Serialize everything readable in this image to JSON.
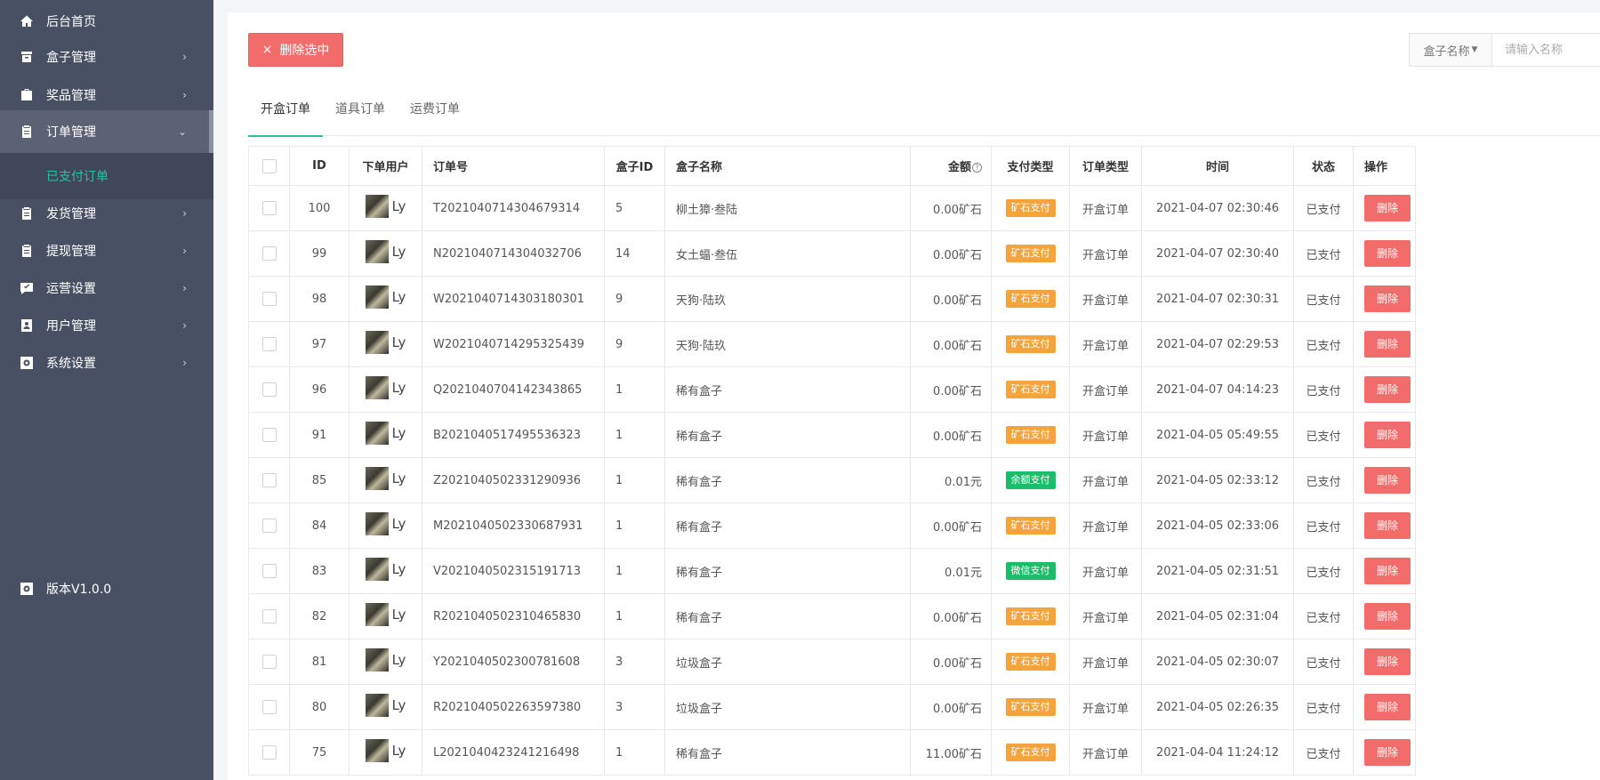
{
  "sidebar": {
    "items": [
      {
        "label": "后台首页",
        "icon": "home-icon",
        "arrow": ""
      },
      {
        "label": "盒子管理",
        "icon": "box-icon",
        "arrow": "›"
      },
      {
        "label": "奖品管理",
        "icon": "bag-icon",
        "arrow": "›"
      },
      {
        "label": "订单管理",
        "icon": "clipboard-icon",
        "arrow": "⌄"
      },
      {
        "label": "发货管理",
        "icon": "clipboard-icon",
        "arrow": "›"
      },
      {
        "label": "提现管理",
        "icon": "clipboard-icon",
        "arrow": "›"
      },
      {
        "label": "运营设置",
        "icon": "chat-icon",
        "arrow": "›"
      },
      {
        "label": "用户管理",
        "icon": "user-card-icon",
        "arrow": "›"
      },
      {
        "label": "系统设置",
        "icon": "gear-icon",
        "arrow": "›"
      }
    ],
    "sub_item": "已支付订单",
    "version": "版本V1.0.0"
  },
  "toolbar": {
    "delete_selected": "删除选中",
    "delete_icon": "×",
    "search_select": "盒子名称",
    "search_placeholder": "请输入名称"
  },
  "tabs": [
    "开盒订单",
    "道具订单",
    "运费订单"
  ],
  "table": {
    "headers": [
      "ID",
      "下单用户",
      "订单号",
      "盒子ID",
      "盒子名称",
      "金额",
      "支付类型",
      "订单类型",
      "时间",
      "状态",
      "操作"
    ],
    "rows": [
      {
        "id": "100",
        "user": "Ly",
        "order_no": "T2021040714304679314",
        "box_id": "5",
        "box_name": "柳土獐·叁陆",
        "amount": "0.00矿石",
        "pay_type": "矿石支付",
        "pay_color": "ore",
        "order_type": "开盒订单",
        "time": "2021-04-07 02:30:46",
        "status": "已支付",
        "action": "删除"
      },
      {
        "id": "99",
        "user": "Ly",
        "order_no": "N2021040714304032706",
        "box_id": "14",
        "box_name": "女土蝠·叁伍",
        "amount": "0.00矿石",
        "pay_type": "矿石支付",
        "pay_color": "ore",
        "order_type": "开盒订单",
        "time": "2021-04-07 02:30:40",
        "status": "已支付",
        "action": "删除"
      },
      {
        "id": "98",
        "user": "Ly",
        "order_no": "W2021040714303180301",
        "box_id": "9",
        "box_name": "天狗·陆玖",
        "amount": "0.00矿石",
        "pay_type": "矿石支付",
        "pay_color": "ore",
        "order_type": "开盒订单",
        "time": "2021-04-07 02:30:31",
        "status": "已支付",
        "action": "删除"
      },
      {
        "id": "97",
        "user": "Ly",
        "order_no": "W2021040714295325439",
        "box_id": "9",
        "box_name": "天狗·陆玖",
        "amount": "0.00矿石",
        "pay_type": "矿石支付",
        "pay_color": "ore",
        "order_type": "开盒订单",
        "time": "2021-04-07 02:29:53",
        "status": "已支付",
        "action": "删除"
      },
      {
        "id": "96",
        "user": "Ly",
        "order_no": "Q2021040704142343865",
        "box_id": "1",
        "box_name": "稀有盒子",
        "amount": "0.00矿石",
        "pay_type": "矿石支付",
        "pay_color": "ore",
        "order_type": "开盒订单",
        "time": "2021-04-07 04:14:23",
        "status": "已支付",
        "action": "删除"
      },
      {
        "id": "91",
        "user": "Ly",
        "order_no": "B2021040517495536323",
        "box_id": "1",
        "box_name": "稀有盒子",
        "amount": "0.00矿石",
        "pay_type": "矿石支付",
        "pay_color": "ore",
        "order_type": "开盒订单",
        "time": "2021-04-05 05:49:55",
        "status": "已支付",
        "action": "删除"
      },
      {
        "id": "85",
        "user": "Ly",
        "order_no": "Z2021040502331290936",
        "box_id": "1",
        "box_name": "稀有盒子",
        "amount": "0.01元",
        "pay_type": "余额支付",
        "pay_color": "bal",
        "order_type": "开盒订单",
        "time": "2021-04-05 02:33:12",
        "status": "已支付",
        "action": "删除"
      },
      {
        "id": "84",
        "user": "Ly",
        "order_no": "M2021040502330687931",
        "box_id": "1",
        "box_name": "稀有盒子",
        "amount": "0.00矿石",
        "pay_type": "矿石支付",
        "pay_color": "ore",
        "order_type": "开盒订单",
        "time": "2021-04-05 02:33:06",
        "status": "已支付",
        "action": "删除"
      },
      {
        "id": "83",
        "user": "Ly",
        "order_no": "V2021040502315191713",
        "box_id": "1",
        "box_name": "稀有盒子",
        "amount": "0.01元",
        "pay_type": "微信支付",
        "pay_color": "wx",
        "order_type": "开盒订单",
        "time": "2021-04-05 02:31:51",
        "status": "已支付",
        "action": "删除"
      },
      {
        "id": "82",
        "user": "Ly",
        "order_no": "R2021040502310465830",
        "box_id": "1",
        "box_name": "稀有盒子",
        "amount": "0.00矿石",
        "pay_type": "矿石支付",
        "pay_color": "ore",
        "order_type": "开盒订单",
        "time": "2021-04-05 02:31:04",
        "status": "已支付",
        "action": "删除"
      },
      {
        "id": "81",
        "user": "Ly",
        "order_no": "Y2021040502300781608",
        "box_id": "3",
        "box_name": "垃圾盒子",
        "amount": "0.00矿石",
        "pay_type": "矿石支付",
        "pay_color": "ore",
        "order_type": "开盒订单",
        "time": "2021-04-05 02:30:07",
        "status": "已支付",
        "action": "删除"
      },
      {
        "id": "80",
        "user": "Ly",
        "order_no": "R2021040502263597380",
        "box_id": "3",
        "box_name": "垃圾盒子",
        "amount": "0.00矿石",
        "pay_type": "矿石支付",
        "pay_color": "ore",
        "order_type": "开盒订单",
        "time": "2021-04-05 02:26:35",
        "status": "已支付",
        "action": "删除"
      },
      {
        "id": "75",
        "user": "Ly",
        "order_no": "L2021040423241216498",
        "box_id": "1",
        "box_name": "稀有盒子",
        "amount": "11.00矿石",
        "pay_type": "矿石支付",
        "pay_color": "ore",
        "order_type": "开盒订单",
        "time": "2021-04-04 11:24:12",
        "status": "已支付",
        "action": "删除"
      }
    ]
  }
}
